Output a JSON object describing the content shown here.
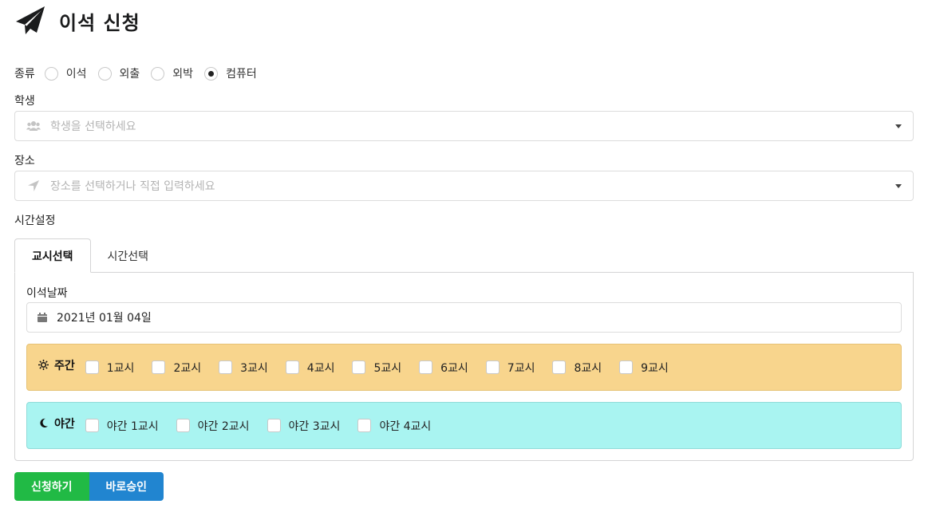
{
  "header": {
    "title": "이석 신청",
    "icon": "paper-plane-icon"
  },
  "type_field": {
    "label": "종류",
    "options": [
      "이석",
      "외출",
      "외박",
      "컴퓨터"
    ],
    "selected": "컴퓨터"
  },
  "student_field": {
    "label": "학생",
    "placeholder": "학생을 선택하세요",
    "icon": "users-icon"
  },
  "place_field": {
    "label": "장소",
    "placeholder": "장소를 선택하거나 직접 입력하세요",
    "icon": "location-arrow-icon"
  },
  "time_settings": {
    "label": "시간설정",
    "tabs": [
      "교시선택",
      "시간선택"
    ],
    "active_tab": "교시선택"
  },
  "period_panel": {
    "date_label": "이석날짜",
    "date_value": "2021년 01월 04일",
    "day": {
      "label": "주간",
      "color": "#f8d58d",
      "periods": [
        "1교시",
        "2교시",
        "3교시",
        "4교시",
        "5교시",
        "6교시",
        "7교시",
        "8교시",
        "9교시"
      ]
    },
    "night": {
      "label": "야간",
      "color": "#a9f4f1",
      "periods": [
        "야간 1교시",
        "야간 2교시",
        "야간 3교시",
        "야간 4교시"
      ]
    }
  },
  "actions": {
    "apply_label": "신청하기",
    "apply_color": "#21ba45",
    "approve_label": "바로승인",
    "approve_color": "#2185d0"
  }
}
